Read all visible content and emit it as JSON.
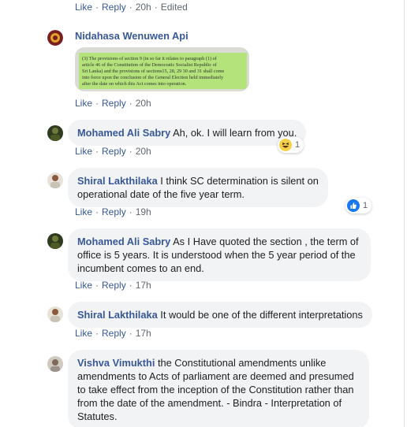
{
  "actions": {
    "like": "Like",
    "reply": "Reply",
    "separator": "·",
    "edited": "Edited"
  },
  "comments": [
    {
      "time": "20h"
    },
    {
      "author": "Nidahasa Wenuwen Api",
      "text": "",
      "attachment": {
        "lines": [
          "(3) The provisions of section 9 (in so far it relates to paragraph (1) of",
          "article 46 of the Constitution of the Democratic Socialist Republic of",
          "Sri Lanka) and the provisions of sections15, 28, 29 30 and 31 shall come",
          "into force upon the conclusion of the General Election held immediately",
          "after the date on which this Act comes into operation."
        ]
      },
      "time": "20h"
    },
    {
      "author": "Mohamed Ali Sabry",
      "text": "Ah, ok. I will learn from you.",
      "time": "20h",
      "reaction": {
        "icon": "haha-emoji-icon",
        "count": "1"
      }
    },
    {
      "author": "Shiral Lakthilaka",
      "text": "I think SC determination is silent on operational date of the five year term.",
      "time": "19h",
      "reaction": {
        "icon": "like-thumb-icon",
        "count": "1"
      }
    },
    {
      "author": "Mohamed Ali Sabry",
      "text": "As I Have quoted the section , the term of office is 5 years. It is understood when the 5 year period of the incumbent comes to an end.",
      "time": "17h"
    },
    {
      "author": "Shiral Lakthilaka",
      "text": "It would be one of the different interpretations",
      "time": "17h"
    },
    {
      "author": "Vishva Vimukthi",
      "text": "the Constitutional amendments unlike amendments to Acts of parliament are deemed and presumed to take effect from the inception of the Constitution rather than from the date of the amendment. - Bindra - Interpretation of Statutes."
    }
  ],
  "colors": {
    "link": "#385898",
    "bubble": "#f2f3f5",
    "meta": "#606770",
    "like_blue": "#1877f2",
    "haha_yellow": "#f7d04b"
  }
}
